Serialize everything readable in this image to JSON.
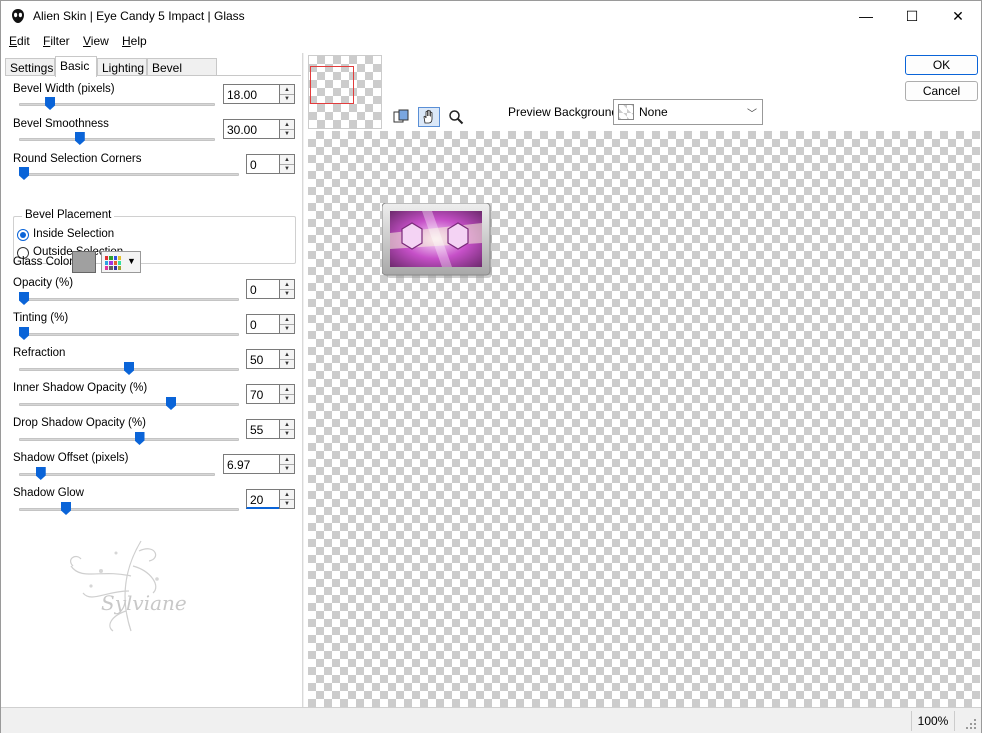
{
  "window": {
    "title": "Alien Skin | Eye Candy 5 Impact | Glass",
    "minimize_glyph": "—",
    "maximize_glyph": "☐",
    "close_glyph": "✕"
  },
  "menu": {
    "edit": {
      "mnemonic": "E",
      "rest": "dit"
    },
    "filter": {
      "mnemonic": "F",
      "rest": "ilter"
    },
    "view": {
      "mnemonic": "V",
      "rest": "iew"
    },
    "help": {
      "mnemonic": "H",
      "rest": "elp"
    }
  },
  "tabs": [
    "Settings",
    "Basic",
    "Lighting",
    "Bevel Profile"
  ],
  "active_tab": "Basic",
  "params": {
    "bevel_width": {
      "label": "Bevel Width (pixels)",
      "value": "18.00",
      "level": 0.14
    },
    "bevel_smoothness": {
      "label": "Bevel Smoothness",
      "value": "30.00",
      "level": 0.3
    },
    "round_corners": {
      "label": "Round Selection Corners",
      "value": "0",
      "level": 0.0
    },
    "opacity": {
      "label": "Opacity (%)",
      "value": "0",
      "level": 0.0
    },
    "tinting": {
      "label": "Tinting (%)",
      "value": "0",
      "level": 0.0
    },
    "refraction": {
      "label": "Refraction",
      "value": "50",
      "level": 0.5
    },
    "inner_shadow_opacity": {
      "label": "Inner Shadow Opacity (%)",
      "value": "70",
      "level": 0.7
    },
    "drop_shadow_opacity": {
      "label": "Drop Shadow Opacity (%)",
      "value": "55",
      "level": 0.55
    },
    "shadow_offset": {
      "label": "Shadow Offset (pixels)",
      "value": "6.97",
      "level": 0.09
    },
    "shadow_glow": {
      "label": "Shadow Glow",
      "value": "20",
      "level": 0.2
    }
  },
  "bevel_placement": {
    "title": "Bevel Placement",
    "inside": "Inside Selection",
    "outside": "Outside Selection",
    "selected": "inside"
  },
  "glass_color": {
    "label": "Glass Color",
    "color": "#a0a0a0"
  },
  "watermark_text": "Sylviane",
  "preview_background": {
    "label": "Preview Background:",
    "value": "None"
  },
  "buttons": {
    "ok": "OK",
    "cancel": "Cancel"
  },
  "status": {
    "zoom": "100%"
  },
  "colors": {
    "accent": "#0a64d8",
    "nav_rect": "#e23c3c"
  }
}
